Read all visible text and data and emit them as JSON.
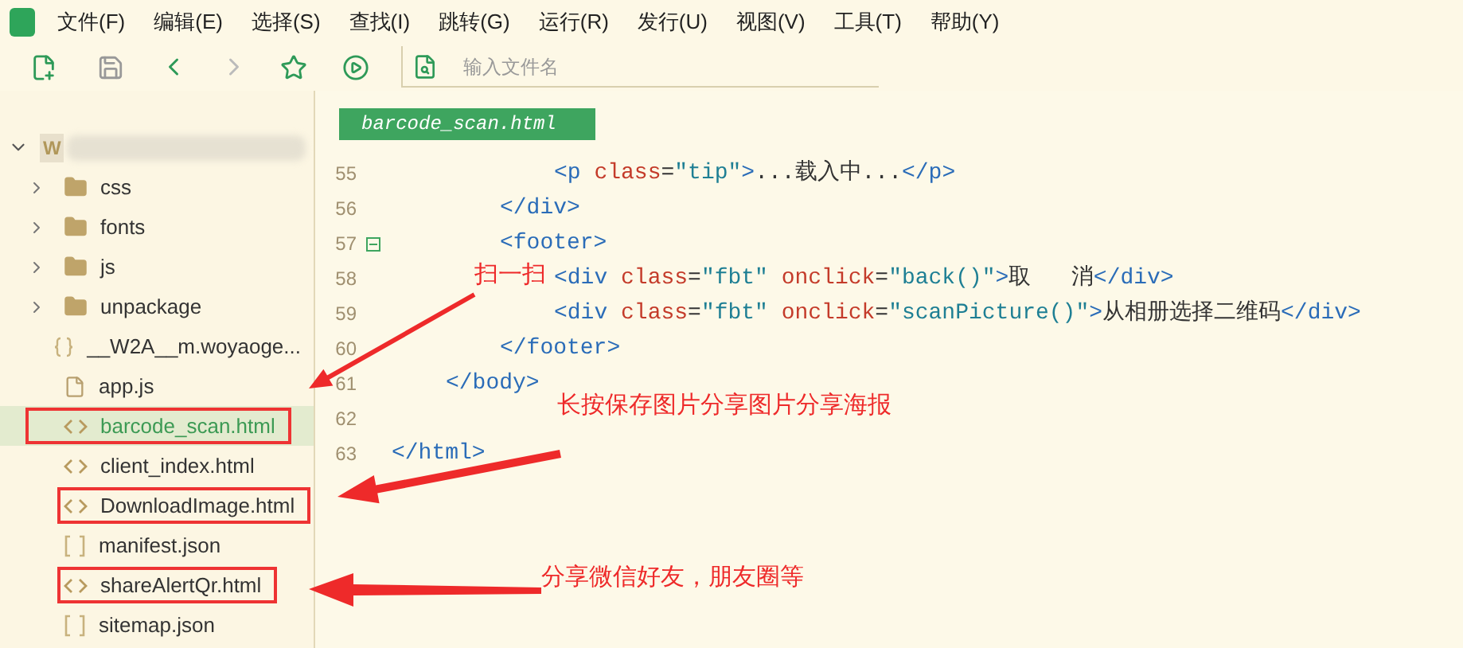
{
  "menu": [
    "文件(F)",
    "编辑(E)",
    "选择(S)",
    "查找(I)",
    "跳转(G)",
    "运行(R)",
    "发行(U)",
    "视图(V)",
    "工具(T)",
    "帮助(Y)"
  ],
  "toolbar": {
    "search": {
      "placeholder": "输入文件名"
    }
  },
  "tree": {
    "label": "W",
    "expanded": true,
    "children": [
      {
        "label": "css",
        "kind": "folder",
        "expanded": false,
        "selected": false,
        "boxed": false
      },
      {
        "label": "fonts",
        "kind": "folder",
        "expanded": false,
        "selected": false,
        "boxed": false
      },
      {
        "label": "js",
        "kind": "folder",
        "expanded": false,
        "selected": false,
        "boxed": false
      },
      {
        "label": "unpackage",
        "kind": "folder",
        "expanded": false,
        "selected": false,
        "boxed": false
      },
      {
        "label": "__W2A__m.woyaoge...",
        "kind": "braces",
        "selected": false,
        "boxed": false
      },
      {
        "label": "app.js",
        "kind": "js",
        "selected": false,
        "boxed": false
      },
      {
        "label": "barcode_scan.html",
        "kind": "html",
        "selected": true,
        "boxed": true
      },
      {
        "label": "client_index.html",
        "kind": "html",
        "selected": false,
        "boxed": false
      },
      {
        "label": "DownloadImage.html",
        "kind": "html",
        "selected": false,
        "boxed": true
      },
      {
        "label": "manifest.json",
        "kind": "bracket",
        "selected": false,
        "boxed": false
      },
      {
        "label": "shareAlertQr.html",
        "kind": "html",
        "selected": false,
        "boxed": true
      },
      {
        "label": "sitemap.json",
        "kind": "bracket",
        "selected": false,
        "boxed": false
      }
    ]
  },
  "editor": {
    "tab": {
      "label": "barcode_scan.html",
      "selected": true
    },
    "lines": [
      {
        "children": [
          {
            "children": [
              {
                "children": [
                  {
                    "number": "55",
                    "fold": false,
                    "tokens": [
                      {
                        "kind": "tag",
                        "text": "<p"
                      },
                      {
                        "kind": "attr",
                        "text": " class"
                      },
                      {
                        "kind": "text",
                        "text": "="
                      },
                      {
                        "kind": "str",
                        "text": "\"tip\""
                      },
                      {
                        "kind": "tag",
                        "text": ">"
                      },
                      {
                        "kind": "text",
                        "text": "...载入中..."
                      },
                      {
                        "kind": "tag",
                        "text": "</p>"
                      }
                    ]
                  }
                ]
              },
              {
                "number": "56",
                "fold": false,
                "tokens": [
                  {
                    "kind": "tag",
                    "text": "</div>"
                  }
                ]
              },
              {
                "number": "57",
                "fold": true,
                "tokens": [
                  {
                    "kind": "tag",
                    "text": "<footer>"
                  }
                ],
                "children": [
                  {
                    "number": "58",
                    "fold": false,
                    "tokens": [
                      {
                        "kind": "tag",
                        "text": "<div"
                      },
                      {
                        "kind": "attr",
                        "text": " class"
                      },
                      {
                        "kind": "text",
                        "text": "="
                      },
                      {
                        "kind": "str",
                        "text": "\"fbt\""
                      },
                      {
                        "kind": "attr",
                        "text": " onclick"
                      },
                      {
                        "kind": "text",
                        "text": "="
                      },
                      {
                        "kind": "str",
                        "text": "\"back()\""
                      },
                      {
                        "kind": "tag",
                        "text": ">"
                      },
                      {
                        "kind": "text",
                        "text": "取   消"
                      },
                      {
                        "kind": "tag",
                        "text": "</div>"
                      }
                    ]
                  },
                  {
                    "number": "59",
                    "fold": false,
                    "tokens": [
                      {
                        "kind": "tag",
                        "text": "<div"
                      },
                      {
                        "kind": "attr",
                        "text": " class"
                      },
                      {
                        "kind": "text",
                        "text": "="
                      },
                      {
                        "kind": "str",
                        "text": "\"fbt\""
                      },
                      {
                        "kind": "attr",
                        "text": " onclick"
                      },
                      {
                        "kind": "text",
                        "text": "="
                      },
                      {
                        "kind": "str",
                        "text": "\"scanPicture()\""
                      },
                      {
                        "kind": "tag",
                        "text": ">"
                      },
                      {
                        "kind": "text",
                        "text": "从相册选择二维码"
                      },
                      {
                        "kind": "tag",
                        "text": "</div>"
                      }
                    ]
                  }
                ]
              },
              {
                "number": "60",
                "fold": false,
                "tokens": [
                  {
                    "kind": "tag",
                    "text": "</footer>"
                  }
                ]
              }
            ]
          },
          {
            "number": "61",
            "fold": false,
            "tokens": [
              {
                "kind": "tag",
                "text": "</body>"
              }
            ]
          }
        ]
      },
      {
        "number": "62",
        "fold": false
      },
      {
        "number": "63",
        "fold": false,
        "tokens": [
          {
            "kind": "tag",
            "text": "</html>"
          }
        ]
      }
    ]
  },
  "annotations": [
    "扫一扫",
    "长按保存图片分享图片分享海报",
    "分享微信好友，朋友圈等"
  ]
}
